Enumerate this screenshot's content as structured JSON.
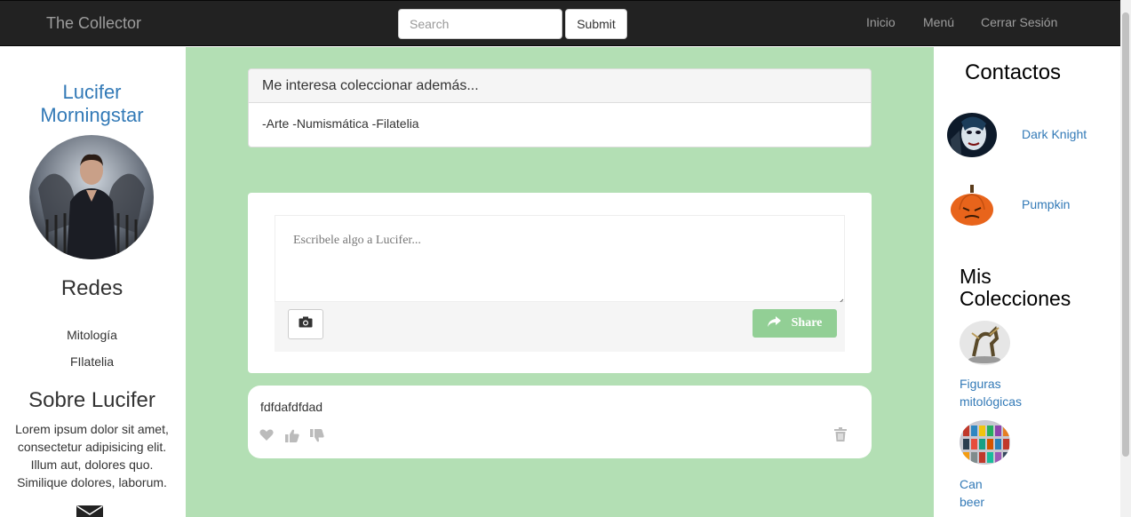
{
  "navbar": {
    "brand": "The Collector",
    "search_placeholder": "Search",
    "submit_label": "Submit",
    "links": [
      "Inicio",
      "Menú",
      "Cerrar Sesión"
    ]
  },
  "profile": {
    "name_line1": "Lucifer",
    "name_line2": "Morningstar",
    "redes_title": "Redes",
    "redes": [
      "Mitología",
      "FIlatelia"
    ],
    "about_title": "Sobre Lucifer",
    "about_text": "Lorem ipsum dolor sit amet, consectetur adipisicing elit. Illum aut, dolores quo. Similique dolores, laborum."
  },
  "interests": {
    "title": "Me interesa coleccionar además...",
    "body": "-Arte -Numismática -Filatelia"
  },
  "composer": {
    "placeholder": "Escribele algo a Lucifer...",
    "share_label": "Share"
  },
  "post": {
    "text": "fdfdafdfdad"
  },
  "contacts": {
    "title": "Contactos",
    "items": [
      {
        "name": "Dark Knight",
        "icon": "joker-avatar"
      },
      {
        "name": "Pumpkin",
        "icon": "pumpkin-avatar"
      }
    ]
  },
  "collections": {
    "title_line1": "Mis",
    "title_line2": "Colecciones",
    "items": [
      {
        "name_line1": "Figuras",
        "name_line2": "mitológicas",
        "icon": "figure-thumb"
      },
      {
        "name_line1": "Can",
        "name_line2": "beer",
        "icon": "cans-thumb"
      }
    ]
  },
  "colors": {
    "navbar_bg": "#222222",
    "center_bg": "#b3dfb4",
    "link": "#337ab7",
    "share_bg": "#92cf95"
  }
}
